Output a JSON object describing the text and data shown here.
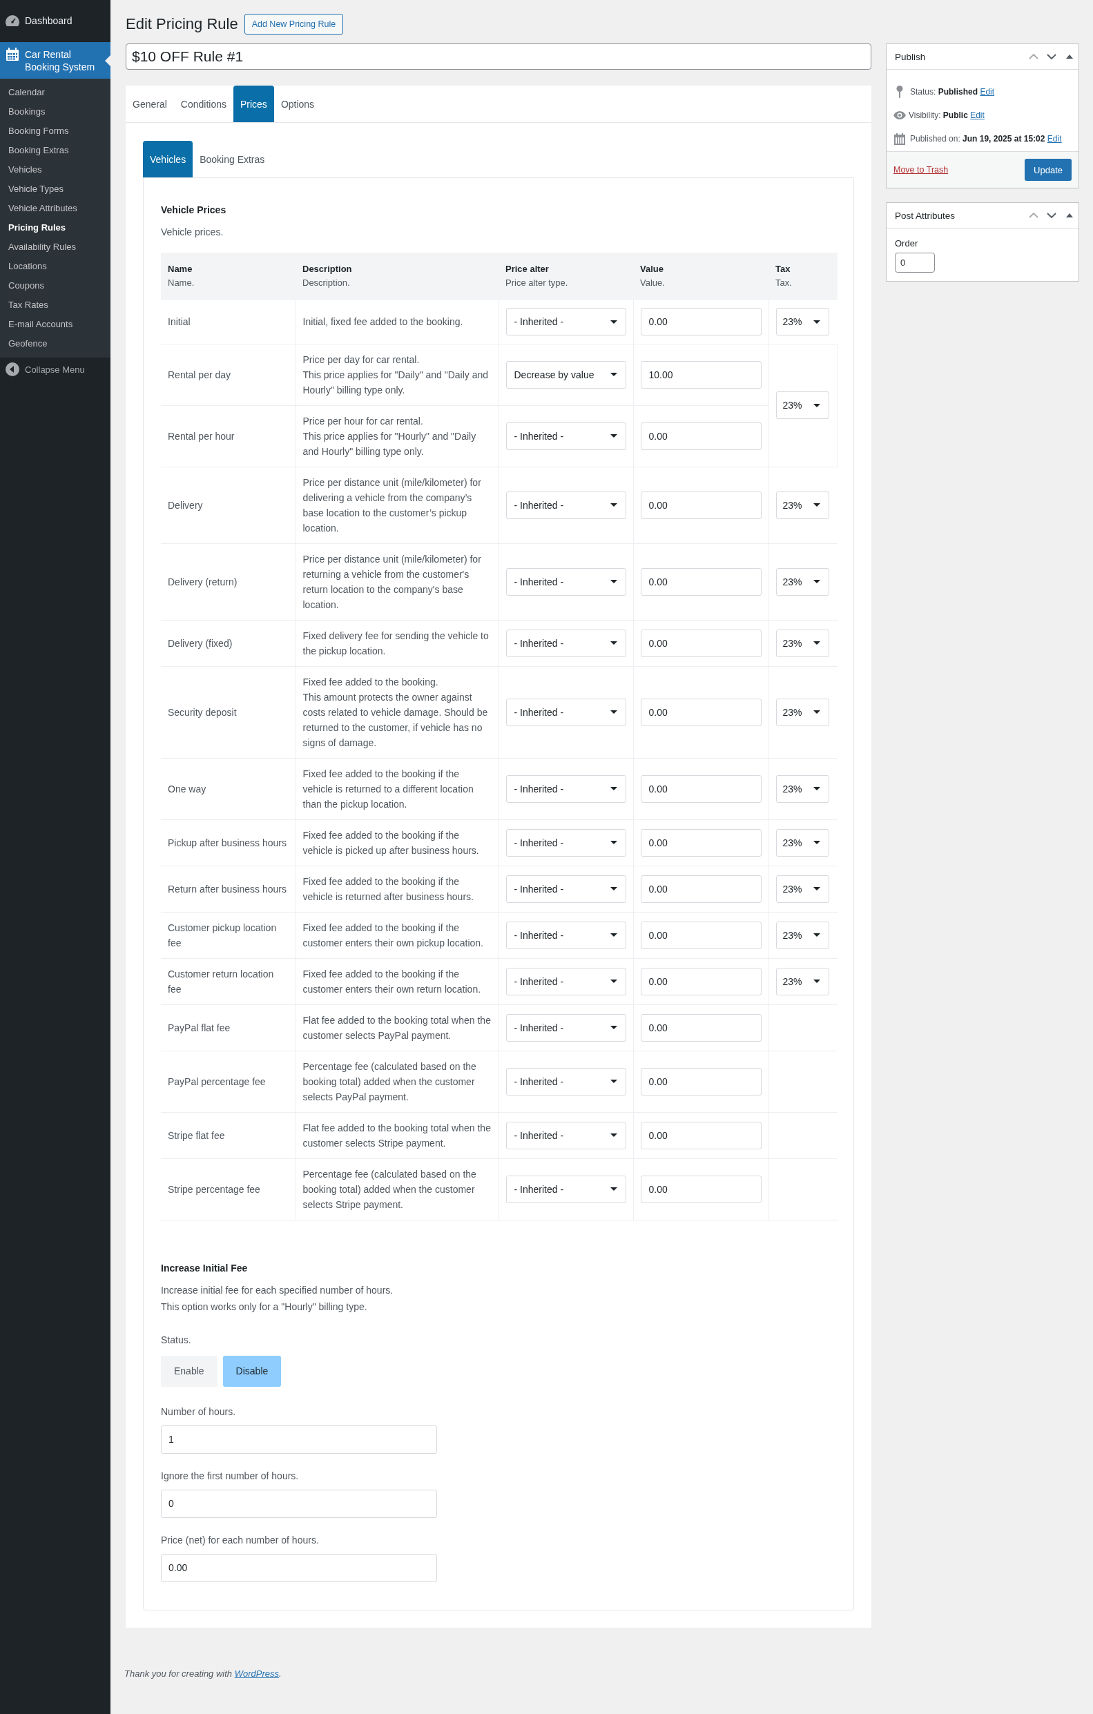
{
  "sidebar": {
    "menu": [
      {
        "label": "Dashboard",
        "selected": false
      },
      {
        "label": "Car Rental Booking System",
        "selected": true
      }
    ],
    "submenu": [
      {
        "label": "Calendar",
        "selected": false
      },
      {
        "label": "Bookings",
        "selected": false
      },
      {
        "label": "Booking Forms",
        "selected": false
      },
      {
        "label": "Booking Extras",
        "selected": false
      },
      {
        "label": "Vehicles",
        "selected": false
      },
      {
        "label": "Vehicle Types",
        "selected": false
      },
      {
        "label": "Vehicle Attributes",
        "selected": false
      },
      {
        "label": "Pricing Rules",
        "selected": true
      },
      {
        "label": "Availability Rules",
        "selected": false
      },
      {
        "label": "Locations",
        "selected": false
      },
      {
        "label": "Coupons",
        "selected": false
      },
      {
        "label": "Tax Rates",
        "selected": false
      },
      {
        "label": "E-mail Accounts",
        "selected": false
      },
      {
        "label": "Geofence",
        "selected": false
      }
    ],
    "collapse": "Collapse Menu"
  },
  "header": {
    "title": "Edit Pricing Rule",
    "add_new_button": "Add New Pricing Rule"
  },
  "post_title": {
    "value": "$10 OFF Rule #1"
  },
  "tabs": [
    {
      "label": "General",
      "selected": false
    },
    {
      "label": "Conditions",
      "selected": false
    },
    {
      "label": "Prices",
      "selected": true
    },
    {
      "label": "Options",
      "selected": false
    }
  ],
  "subtabs": [
    {
      "label": "Vehicles",
      "selected": true
    },
    {
      "label": "Booking Extras",
      "selected": false
    }
  ],
  "vehicle_prices": {
    "title": "Vehicle Prices",
    "description": "Vehicle prices.",
    "columns": [
      {
        "label": "Name",
        "hint": "Name."
      },
      {
        "label": "Description",
        "hint": "Description."
      },
      {
        "label": "Price alter",
        "hint": "Price alter type."
      },
      {
        "label": "Value",
        "hint": "Value."
      },
      {
        "label": "Tax",
        "hint": "Tax."
      }
    ],
    "tax_groups": [
      {
        "tax": "23%",
        "rows": [
          {
            "name": "Initial",
            "description": "Initial, fixed fee added to the booking.",
            "price_alter": "- Inherited -",
            "value": "0.00"
          }
        ]
      },
      {
        "tax": "23%",
        "rows": [
          {
            "name": "Rental per day",
            "description": "Price per day for car rental.\nThis price applies for \"Daily\" and \"Daily and Hourly\" billing type only.",
            "price_alter": "Decrease by value",
            "value": "10.00"
          },
          {
            "name": "Rental per hour",
            "description": "Price per hour for car rental.\nThis price applies for \"Hourly\" and \"Daily and Hourly\" billing type only.",
            "price_alter": "- Inherited -",
            "value": "0.00"
          }
        ]
      },
      {
        "tax": "23%",
        "rows": [
          {
            "name": "Delivery",
            "description": "Price per distance unit (mile/kilometer) for delivering a vehicle from the company’s base location to the customer’s pickup location.",
            "price_alter": "- Inherited -",
            "value": "0.00"
          }
        ]
      },
      {
        "tax": "23%",
        "rows": [
          {
            "name": "Delivery (return)",
            "description": "Price per distance unit (mile/kilometer) for returning a vehicle from the customer's return location to the company's base location.",
            "price_alter": "- Inherited -",
            "value": "0.00"
          }
        ]
      },
      {
        "tax": "23%",
        "rows": [
          {
            "name": "Delivery (fixed)",
            "description": "Fixed delivery fee for sending the vehicle to the pickup location.",
            "price_alter": "- Inherited -",
            "value": "0.00"
          }
        ]
      },
      {
        "tax": "23%",
        "rows": [
          {
            "name": "Security deposit",
            "description": "Fixed fee added to the booking.\nThis amount protects the owner against costs related to vehicle damage. Should be returned to the customer, if vehicle has no signs of damage.",
            "price_alter": "- Inherited -",
            "value": "0.00"
          }
        ]
      },
      {
        "tax": "23%",
        "rows": [
          {
            "name": "One way",
            "description": "Fixed fee added to the booking if the vehicle is returned to a different location than the pickup location.",
            "price_alter": "- Inherited -",
            "value": "0.00"
          }
        ]
      },
      {
        "tax": "23%",
        "rows": [
          {
            "name": "Pickup after business hours",
            "description": "Fixed fee added to the booking if the vehicle is picked up after business hours.",
            "price_alter": "- Inherited -",
            "value": "0.00"
          }
        ]
      },
      {
        "tax": "23%",
        "rows": [
          {
            "name": "Return after business hours",
            "description": "Fixed fee added to the booking if the vehicle is returned after business hours.",
            "price_alter": "- Inherited -",
            "value": "0.00"
          }
        ]
      },
      {
        "tax": "23%",
        "rows": [
          {
            "name": "Customer pickup location fee",
            "description": "Fixed fee added to the booking if the customer enters their own pickup location.",
            "price_alter": "- Inherited -",
            "value": "0.00"
          }
        ]
      },
      {
        "tax": "23%",
        "rows": [
          {
            "name": "Customer return location fee",
            "description": "Fixed fee added to the booking if the customer enters their own return location.",
            "price_alter": "- Inherited -",
            "value": "0.00"
          }
        ]
      },
      {
        "rows": [
          {
            "name": "PayPal flat fee",
            "description": "Flat fee added to the booking total when the customer selects PayPal payment.",
            "price_alter": "- Inherited -",
            "value": "0.00"
          }
        ]
      },
      {
        "rows": [
          {
            "name": "PayPal percentage fee",
            "description": "Percentage fee (calculated based on the booking total) added when the customer selects PayPal payment.",
            "price_alter": "- Inherited -",
            "value": "0.00"
          }
        ]
      },
      {
        "rows": [
          {
            "name": "Stripe flat fee",
            "description": "Flat fee added to the booking total when the customer selects Stripe payment.",
            "price_alter": "- Inherited -",
            "value": "0.00"
          }
        ]
      },
      {
        "rows": [
          {
            "name": "Stripe percentage fee",
            "description": "Percentage fee (calculated based on the booking total) added when the customer selects Stripe payment.",
            "price_alter": "- Inherited -",
            "value": "0.00"
          }
        ]
      }
    ]
  },
  "increase_initial_fee": {
    "title": "Increase Initial Fee",
    "description": "Increase initial fee for each specified number of hours.\nThis option works only for a \"Hourly\" billing type.",
    "status_label": "Status.",
    "status_options": [
      {
        "label": "Enable",
        "selected": false
      },
      {
        "label": "Disable",
        "selected": true
      }
    ],
    "fields": [
      {
        "label": "Number of hours.",
        "value": "1"
      },
      {
        "label": "Ignore the first number of hours.",
        "value": "0"
      },
      {
        "label": "Price (net) for each number of hours.",
        "value": "0.00"
      }
    ]
  },
  "publish": {
    "title": "Publish",
    "items": [
      {
        "text": "Status: **Published**",
        "link": "Edit"
      },
      {
        "text": "Visibility: **Public**",
        "link": "Edit"
      },
      {
        "text": "Published on: **Jun 19, 2025 at 15:02**",
        "link": "Edit"
      }
    ],
    "trash": "Move to Trash",
    "update": "Update"
  },
  "post_attributes": {
    "title": "Post Attributes",
    "order_label": "Order",
    "order_value": "0"
  },
  "footer": {
    "text": "Thank you for creating with",
    "link": "WordPress",
    "after": "."
  }
}
